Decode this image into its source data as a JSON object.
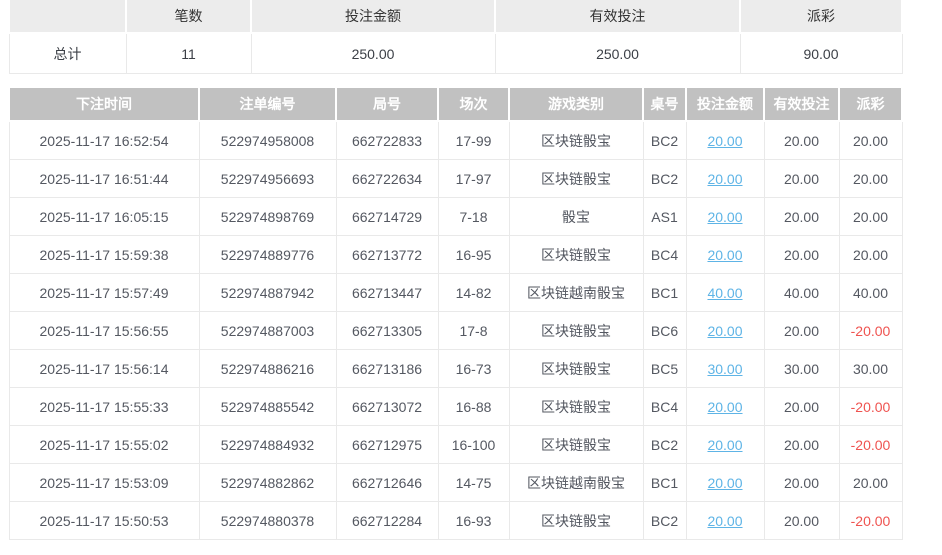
{
  "colors": {
    "header_bg": "#c1c1c1",
    "header_text": "#ffffff",
    "summary_header_bg": "#ececec",
    "body_text": "#545861",
    "border_light": "#e9e9e9",
    "link_blue": "#5eb4e6",
    "negative_red": "#ef5350",
    "page_bg": "#ffffff"
  },
  "summary": {
    "headers": [
      "",
      "笔数",
      "投注金额",
      "有效投注",
      "派彩"
    ],
    "row_label": "总计",
    "bet_count": "11",
    "bet_amount": "250.00",
    "valid_bet": "250.00",
    "payout": "90.00"
  },
  "main_table": {
    "headers": [
      "下注时间",
      "注单编号",
      "局号",
      "场次",
      "游戏类别",
      "桌号",
      "投注金额",
      "有效投注",
      "派彩"
    ],
    "columns": [
      "time",
      "order_no",
      "round_no",
      "session",
      "game",
      "table_no",
      "bet_amount",
      "valid_bet",
      "payout"
    ],
    "rows": [
      {
        "time": "2025-11-17 16:52:54",
        "order_no": "522974958008",
        "round_no": "662722833",
        "session": "17-99",
        "game": "区块链骰宝",
        "table_no": "BC2",
        "bet_amount": "20.00",
        "valid_bet": "20.00",
        "payout": "20.00"
      },
      {
        "time": "2025-11-17 16:51:44",
        "order_no": "522974956693",
        "round_no": "662722634",
        "session": "17-97",
        "game": "区块链骰宝",
        "table_no": "BC2",
        "bet_amount": "20.00",
        "valid_bet": "20.00",
        "payout": "20.00"
      },
      {
        "time": "2025-11-17 16:05:15",
        "order_no": "522974898769",
        "round_no": "662714729",
        "session": "7-18",
        "game": "骰宝",
        "table_no": "AS1",
        "bet_amount": "20.00",
        "valid_bet": "20.00",
        "payout": "20.00"
      },
      {
        "time": "2025-11-17 15:59:38",
        "order_no": "522974889776",
        "round_no": "662713772",
        "session": "16-95",
        "game": "区块链骰宝",
        "table_no": "BC4",
        "bet_amount": "20.00",
        "valid_bet": "20.00",
        "payout": "20.00"
      },
      {
        "time": "2025-11-17 15:57:49",
        "order_no": "522974887942",
        "round_no": "662713447",
        "session": "14-82",
        "game": "区块链越南骰宝",
        "table_no": "BC1",
        "bet_amount": "40.00",
        "valid_bet": "40.00",
        "payout": "40.00"
      },
      {
        "time": "2025-11-17 15:56:55",
        "order_no": "522974887003",
        "round_no": "662713305",
        "session": "17-8",
        "game": "区块链骰宝",
        "table_no": "BC6",
        "bet_amount": "20.00",
        "valid_bet": "20.00",
        "payout": "-20.00"
      },
      {
        "time": "2025-11-17 15:56:14",
        "order_no": "522974886216",
        "round_no": "662713186",
        "session": "16-73",
        "game": "区块链骰宝",
        "table_no": "BC5",
        "bet_amount": "30.00",
        "valid_bet": "30.00",
        "payout": "30.00"
      },
      {
        "time": "2025-11-17 15:55:33",
        "order_no": "522974885542",
        "round_no": "662713072",
        "session": "16-88",
        "game": "区块链骰宝",
        "table_no": "BC4",
        "bet_amount": "20.00",
        "valid_bet": "20.00",
        "payout": "-20.00"
      },
      {
        "time": "2025-11-17 15:55:02",
        "order_no": "522974884932",
        "round_no": "662712975",
        "session": "16-100",
        "game": "区块链骰宝",
        "table_no": "BC2",
        "bet_amount": "20.00",
        "valid_bet": "20.00",
        "payout": "-20.00"
      },
      {
        "time": "2025-11-17 15:53:09",
        "order_no": "522974882862",
        "round_no": "662712646",
        "session": "14-75",
        "game": "区块链越南骰宝",
        "table_no": "BC1",
        "bet_amount": "20.00",
        "valid_bet": "20.00",
        "payout": "20.00"
      },
      {
        "time": "2025-11-17 15:50:53",
        "order_no": "522974880378",
        "round_no": "662712284",
        "session": "16-93",
        "game": "区块链骰宝",
        "table_no": "BC2",
        "bet_amount": "20.00",
        "valid_bet": "20.00",
        "payout": "-20.00"
      }
    ]
  }
}
